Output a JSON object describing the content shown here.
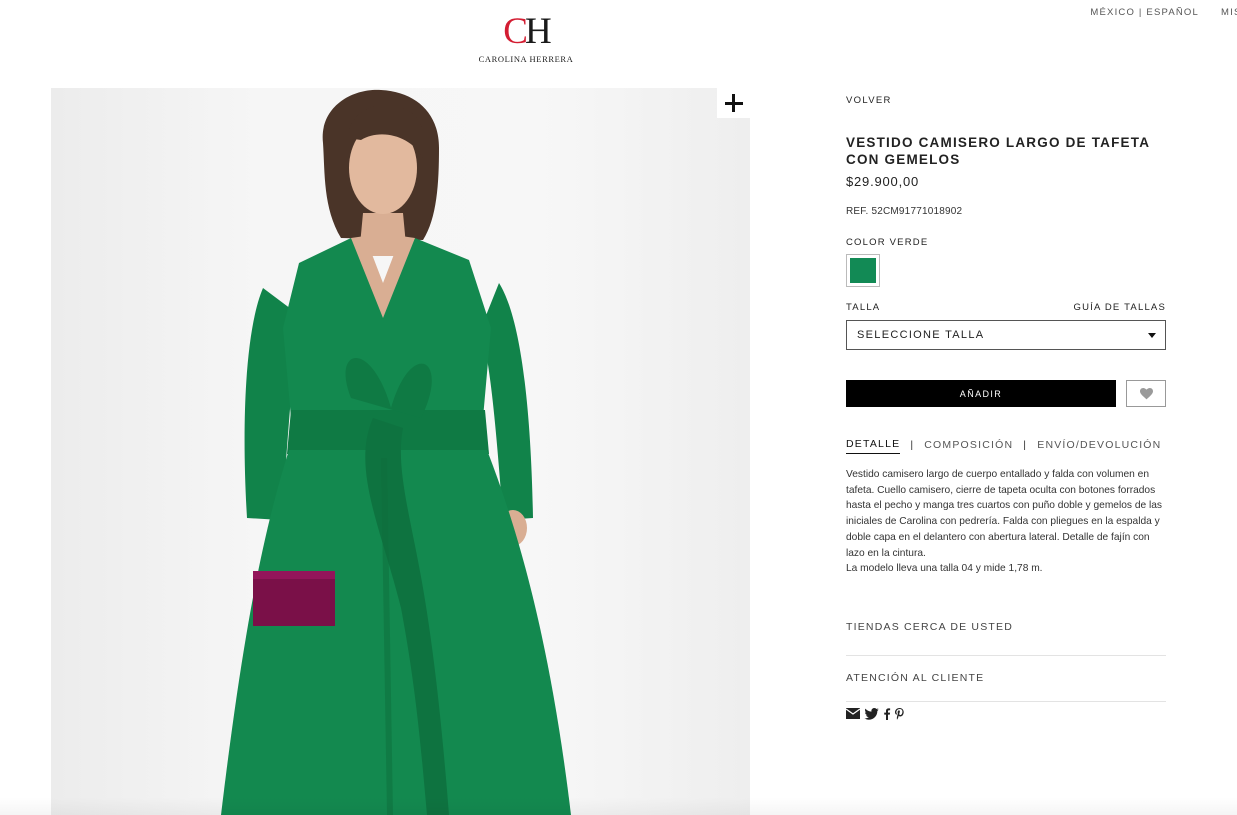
{
  "header": {
    "logo_mark_c": "C",
    "logo_mark_h": "H",
    "logo_wordmark": "CAROLINA HERRERA",
    "locale": "MÉXICO | ESPAÑOL",
    "account_partial": "MIS",
    "brand_red": "#d31d32"
  },
  "product": {
    "back_label": "VOLVER",
    "title": "VESTIDO CAMISERO LARGO DE TAFETA CON GEMELOS",
    "price": "$29.900,00",
    "ref": "REF. 52CM91771018902",
    "color_label": "COLOR VERDE",
    "swatch_color": "#128a55",
    "dress_color": "#13894f",
    "size_label": "TALLA",
    "size_guide": "GUÍA DE TALLAS",
    "size_select": "SELECCIONE TALLA",
    "add_button": "AÑADIR",
    "tabs": [
      {
        "label": "DETALLE",
        "active": true
      },
      {
        "label": "COMPOSICIÓN",
        "active": false
      },
      {
        "label": "ENVÍO/DEVOLUCIÓN",
        "active": false
      }
    ],
    "tab_separator": "|",
    "description": "Vestido camisero largo de cuerpo entallado y falda con volumen en tafeta. Cuello camisero, cierre de tapeta oculta con botones forrados hasta el pecho y manga tres cuartos con puño doble y gemelos de las iniciales de Carolina con pedrería. Falda con pliegues en la espalda y doble capa en el delantero con abertura lateral. Detalle de fajín con lazo en la cintura.",
    "model_note": "La modelo lleva una talla 04 y mide 1,78 m."
  },
  "links": {
    "stores": "TIENDAS CERCA DE USTED",
    "customer_service": "ATENCIÓN AL CLIENTE"
  },
  "social": {
    "icons": [
      "email-icon",
      "twitter-icon",
      "facebook-icon",
      "pinterest-icon"
    ]
  }
}
